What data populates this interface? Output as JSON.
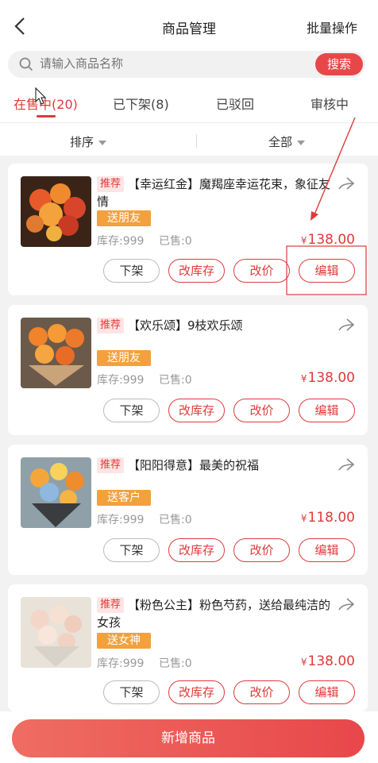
{
  "header": {
    "title": "商品管理",
    "batch_label": "批量操作"
  },
  "search": {
    "placeholder": "请输入商品名称",
    "button_label": "搜索"
  },
  "tabs": [
    {
      "label": "在售中",
      "count": "(20)"
    },
    {
      "label": "已下架",
      "count": "(8)"
    },
    {
      "label": "已驳回",
      "count": ""
    },
    {
      "label": "审核中",
      "count": ""
    }
  ],
  "filters": {
    "sort_label": "排序",
    "scope_label": "全部"
  },
  "products": [
    {
      "recommend": "推荐",
      "name": "【幸运红金】魔羯座幸运花束，象征友情",
      "tag": "送朋友",
      "stock": "库存:999",
      "sold": "已售:0",
      "currency": "¥",
      "price": "138.00"
    },
    {
      "recommend": "推荐",
      "name": "【欢乐颂】9枝欢乐颂",
      "tag": "送朋友",
      "stock": "库存:999",
      "sold": "已售:0",
      "currency": "¥",
      "price": "138.00"
    },
    {
      "recommend": "推荐",
      "name": "【阳阳得意】最美的祝福",
      "tag": "送客户",
      "stock": "库存:999",
      "sold": "已售:0",
      "currency": "¥",
      "price": "118.00"
    },
    {
      "recommend": "推荐",
      "name": "【粉色公主】粉色芍药，送给最纯洁的女孩",
      "tag": "送女神",
      "stock": "库存:999",
      "sold": "已售:0",
      "currency": "¥",
      "price": "138.00"
    }
  ],
  "actions": {
    "delist": "下架",
    "edit_stock": "改库存",
    "edit_price": "改价",
    "edit": "编辑"
  },
  "footer": {
    "add_label": "新增商品"
  },
  "colors": {
    "accent": "#e0393b",
    "tag": "#f2a13c"
  }
}
